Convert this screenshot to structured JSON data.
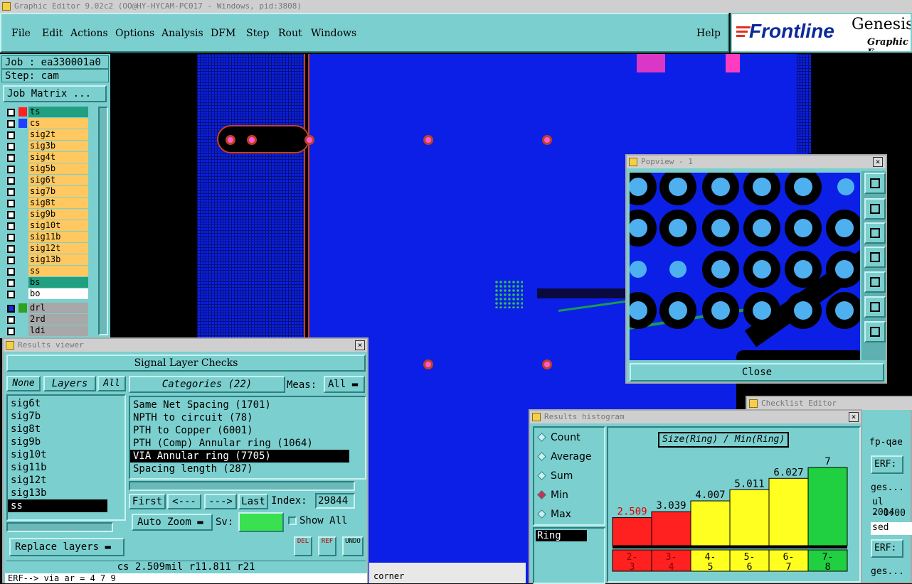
{
  "window": {
    "title": "Graphic Editor 9.02c2 (OO@HY-HYCAM-PC017 - Windows, pid:3808)"
  },
  "menu": {
    "items": [
      "File",
      "Edit",
      "Actions",
      "Options",
      "Analysis",
      "DFM",
      "Step",
      "Rout",
      "Windows"
    ],
    "help": "Help"
  },
  "brand": {
    "frontline": "Frontline",
    "genesis": "Genesis",
    "subtitle": "Graphic E"
  },
  "job": {
    "job": "Job : ea330001a0",
    "step": "Step: cam",
    "matrix_btn": "Job Matrix ..."
  },
  "layers": [
    "ts",
    "cs",
    "sig2t",
    "sig3b",
    "sig4t",
    "sig5b",
    "sig6t",
    "sig7b",
    "sig8t",
    "sig9b",
    "sig10t",
    "sig11b",
    "sig12t",
    "sig13b",
    "ss",
    "bs",
    "bo"
  ],
  "drill_layers": [
    "drl",
    "2rd",
    "ldi"
  ],
  "results_viewer": {
    "title": "Results viewer",
    "header": "Signal Layer Checks",
    "none": "None",
    "layers": "Layers",
    "all": "All",
    "categories_btn": "Categories (22)",
    "meas_label": "Meas:",
    "meas_value": "All",
    "layer_list": [
      "sig6t",
      "sig7b",
      "sig8t",
      "sig9b",
      "sig10t",
      "sig11b",
      "sig12t",
      "sig13b",
      "ss"
    ],
    "categories": [
      "Same Net Spacing (1701)",
      "NPTH to circuit (78)",
      "PTH to Copper (6001)",
      "PTH (Comp) Annular ring (1064)",
      "VIA Annular ring (7705)",
      "Spacing length (287)"
    ],
    "first": "First",
    "prev": "<---",
    "next": "--->",
    "last": "Last",
    "index_label": "Index:",
    "index_value": "29844",
    "auto_zoom": "Auto Zoom",
    "sv_label": "Sv:",
    "show_all": "Show All",
    "replace_layers": "Replace layers",
    "del": "DEL",
    "ref": "REF",
    "undo": "UNDO",
    "status": "cs 2.509mil   r11.811   r21",
    "erf": "ERF--> via ar = 4 7 9"
  },
  "corner_label": "corner",
  "popview": {
    "title": "Popview - 1",
    "close": "Close"
  },
  "checklist": {
    "title": "Checklist Editor",
    "fp": "fp-qae",
    "erf": "ERF:",
    "ges": "ges...",
    "date1": "ul 2014",
    "date2": "- 0:00",
    "sed": "sed",
    "erf2": "ERF:",
    "ges2": "ges..."
  },
  "histogram": {
    "title": "Results histogram",
    "options": [
      "Count",
      "Average",
      "Sum",
      "Min",
      "Max"
    ],
    "selected_option": "Min",
    "list_item": "Ring",
    "chart_title": "Size(Ring) / Min(Ring)"
  },
  "colors": {
    "teal": "#7ccfcf",
    "board": "#0b1fe6",
    "red": "#ff2020",
    "yellow": "#ffff20",
    "green": "#20d040"
  },
  "chart_data": {
    "type": "bar",
    "title": "Size(Ring) / Min(Ring)",
    "categories": [
      "2-3",
      "3-4",
      "4-5",
      "5-6",
      "6-7",
      "7-8"
    ],
    "values": [
      2.509,
      3.039,
      4.007,
      5.011,
      6.027,
      7
    ],
    "value_labels": [
      "2.509",
      "3.039",
      "4.007",
      "5.011",
      "6.027",
      "7"
    ],
    "bar_colors": [
      "#ff2020",
      "#ff2020",
      "#ffff20",
      "#ffff20",
      "#ffff20",
      "#20d040"
    ],
    "label_colors": [
      "#e00000",
      "#000000",
      "#000000",
      "#000000",
      "#000000",
      "#000000"
    ],
    "ylim": [
      0,
      7.6
    ]
  }
}
